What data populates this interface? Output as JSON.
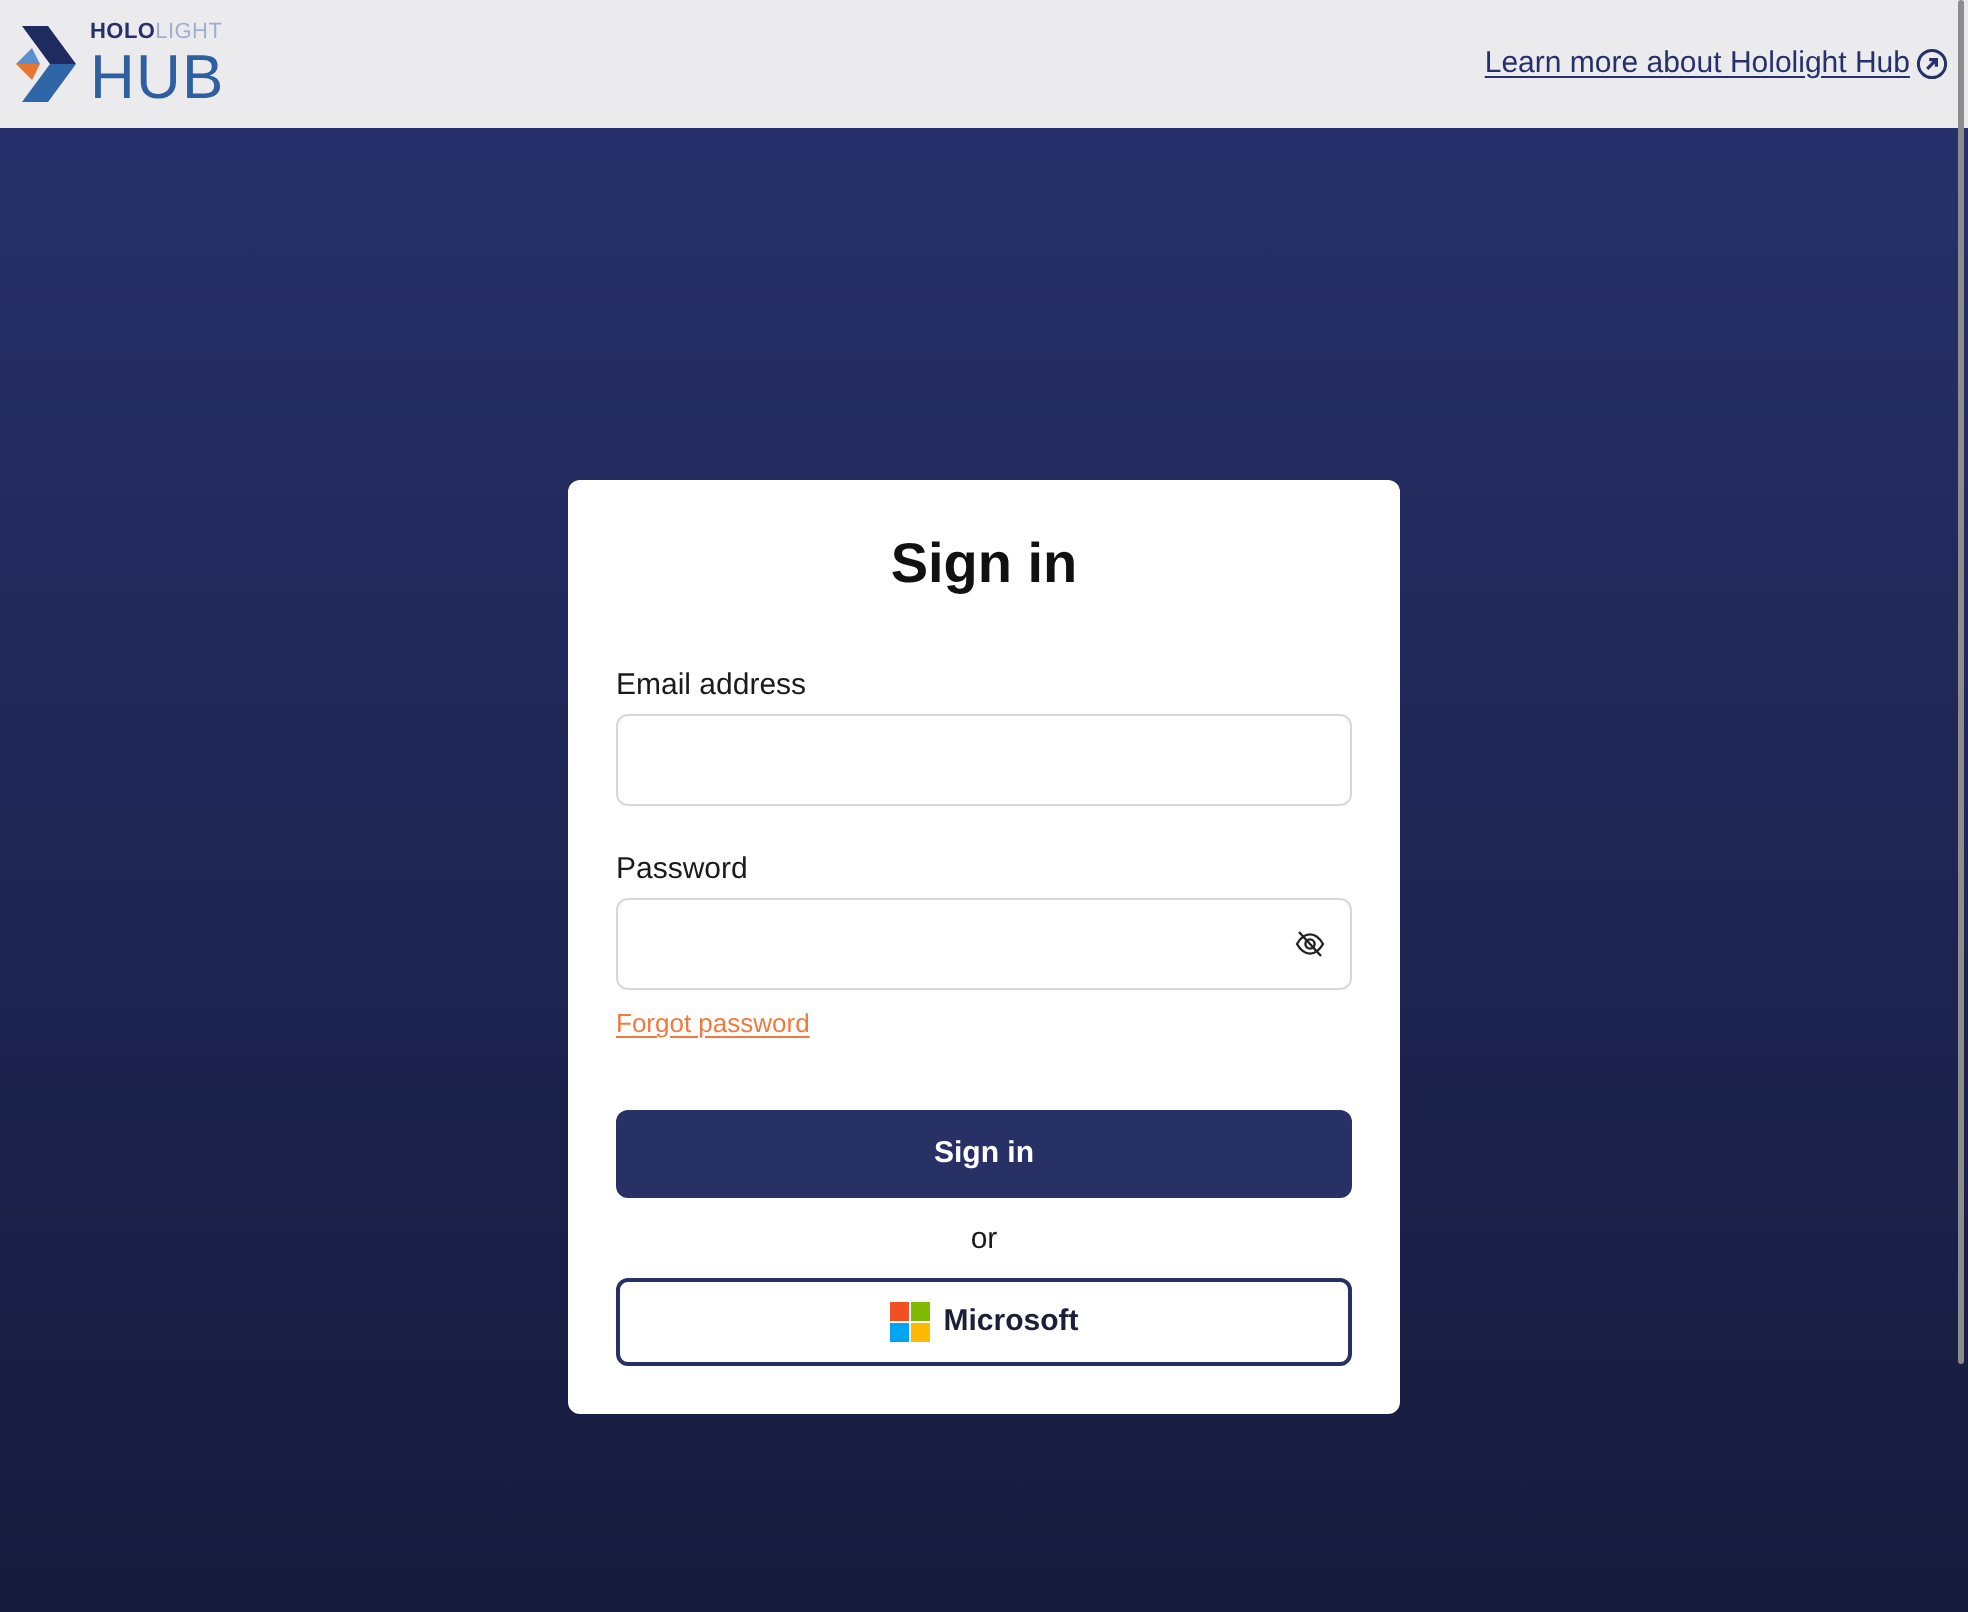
{
  "header": {
    "logo": {
      "brand": "**HOLO**LIGHT",
      "product": "HUB"
    },
    "learn_more_link": "Learn more about Hololight Hub"
  },
  "sign_in_card": {
    "title": "Sign in",
    "fields": [
      {
        "label": "Email address",
        "kind": "email"
      },
      {
        "label": "Password",
        "kind": "password"
      }
    ],
    "forgot_password_link": "Forgot password",
    "submit_button": "Sign in",
    "divider_text": "or",
    "sso_buttons": [
      {
        "label": "Microsoft",
        "kind": "microsoft"
      }
    ]
  }
}
